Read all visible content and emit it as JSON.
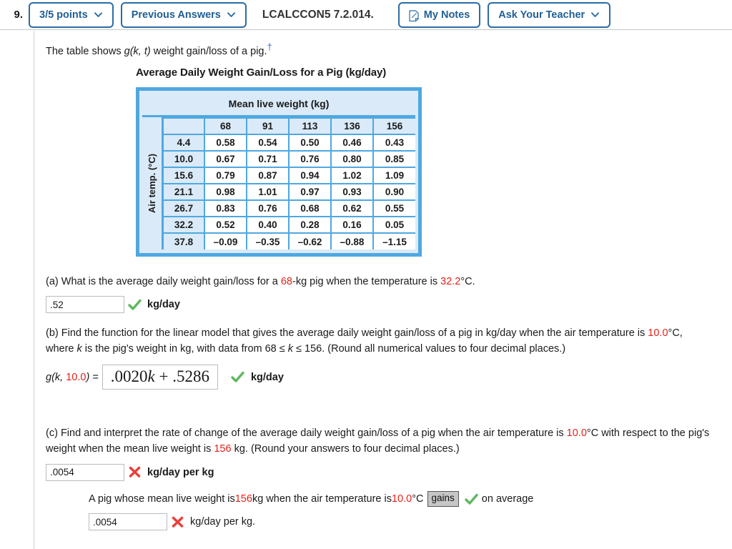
{
  "header": {
    "question_number": "9.",
    "points_label": "3/5 points",
    "previous_answers_label": "Previous Answers",
    "assignment_code": "LCALCCON5 7.2.014.",
    "my_notes_label": "My Notes",
    "ask_teacher_label": "Ask Your Teacher",
    "notes_icon": "document-note-icon",
    "chevron_icon": "chevron-down-icon",
    "accent_blue": "#2b6ca3"
  },
  "intro": {
    "before": "The table shows ",
    "func": "g(k, t)",
    "after": " weight gain/loss of a pig.",
    "dagger": "†"
  },
  "figure": {
    "title": "Average Daily Weight Gain/Loss for a Pig (kg/day)",
    "top_header": "Mean live weight (kg)",
    "axis_label": "Air temp. (°C)",
    "border_color": "#4fa8e0",
    "header_fill": "#daeaf8"
  },
  "chart_data": {
    "type": "table",
    "title": "Average Daily Weight Gain/Loss for a Pig (kg/day)",
    "xlabel": "Mean live weight (kg)",
    "ylabel": "Air temp. (°C)",
    "columns": [
      "68",
      "91",
      "113",
      "136",
      "156"
    ],
    "rows": [
      "4.4",
      "10.0",
      "15.6",
      "21.1",
      "26.7",
      "32.2",
      "37.8"
    ],
    "values": [
      [
        "0.58",
        "0.54",
        "0.50",
        "0.46",
        "0.43"
      ],
      [
        "0.67",
        "0.71",
        "0.76",
        "0.80",
        "0.85"
      ],
      [
        "0.79",
        "0.87",
        "0.94",
        "1.02",
        "1.09"
      ],
      [
        "0.98",
        "1.01",
        "0.97",
        "0.93",
        "0.90"
      ],
      [
        "0.83",
        "0.76",
        "0.68",
        "0.62",
        "0.55"
      ],
      [
        "0.52",
        "0.40",
        "0.28",
        "0.16",
        "0.05"
      ],
      [
        "–0.09",
        "–0.35",
        "–0.62",
        "–0.88",
        "–1.15"
      ]
    ]
  },
  "parts": {
    "a": {
      "label": "(a)",
      "text_1": "What is the average daily weight gain/loss for a ",
      "hl_1": "68",
      "text_2": "-kg pig when the temperature is ",
      "hl_2": "32.2",
      "text_3": "°C.",
      "answer_value": ".52",
      "status": "correct",
      "unit": "kg/day"
    },
    "b": {
      "label": "(b)",
      "text_1": "Find the function for the linear model that gives the average daily weight gain/loss of a pig in kg/day when the air temperature is ",
      "hl_1": "10.0",
      "text_2": "°C, where ",
      "var_k": "k",
      "text_3": " is the pig's weight in kg, with data from  68 ≤ ",
      "var_k2": "k",
      "text_4": " ≤ 156.  (Round all numerical values to four decimal places.)",
      "lhs_pre": "g(k, ",
      "lhs_hl": "10.0",
      "lhs_post": ") =",
      "answer_coef": ".0020",
      "answer_var": "k",
      "answer_rest": " + .5286",
      "status": "correct",
      "unit": "kg/day"
    },
    "c": {
      "label": "(c)",
      "text_1": "Find and interpret the rate of change of the average daily weight gain/loss of a pig when the air temperature is ",
      "hl_1": "10.0",
      "text_2": "°C with respect to the pig's weight when the mean live weight is ",
      "hl_2": "156",
      "text_3": " kg. (Round your answers to four decimal places.)",
      "answer_value": ".0054",
      "status": "incorrect",
      "unit": "kg/day per kg",
      "interpret": {
        "text_1": "A pig whose mean live weight is ",
        "hl_1": "156",
        "text_2": " kg when the air temperature is ",
        "hl_2": "10.0",
        "text_3": "°C",
        "dropdown_value": "gains",
        "dropdown_status": "correct",
        "text_4": "on average",
        "answer_value": ".0054",
        "status": "incorrect",
        "unit": "kg/day per kg."
      }
    }
  },
  "colors": {
    "highlight_red": "#e32119",
    "correct_green": "#5cb85c",
    "incorrect_red": "#e8413a"
  }
}
